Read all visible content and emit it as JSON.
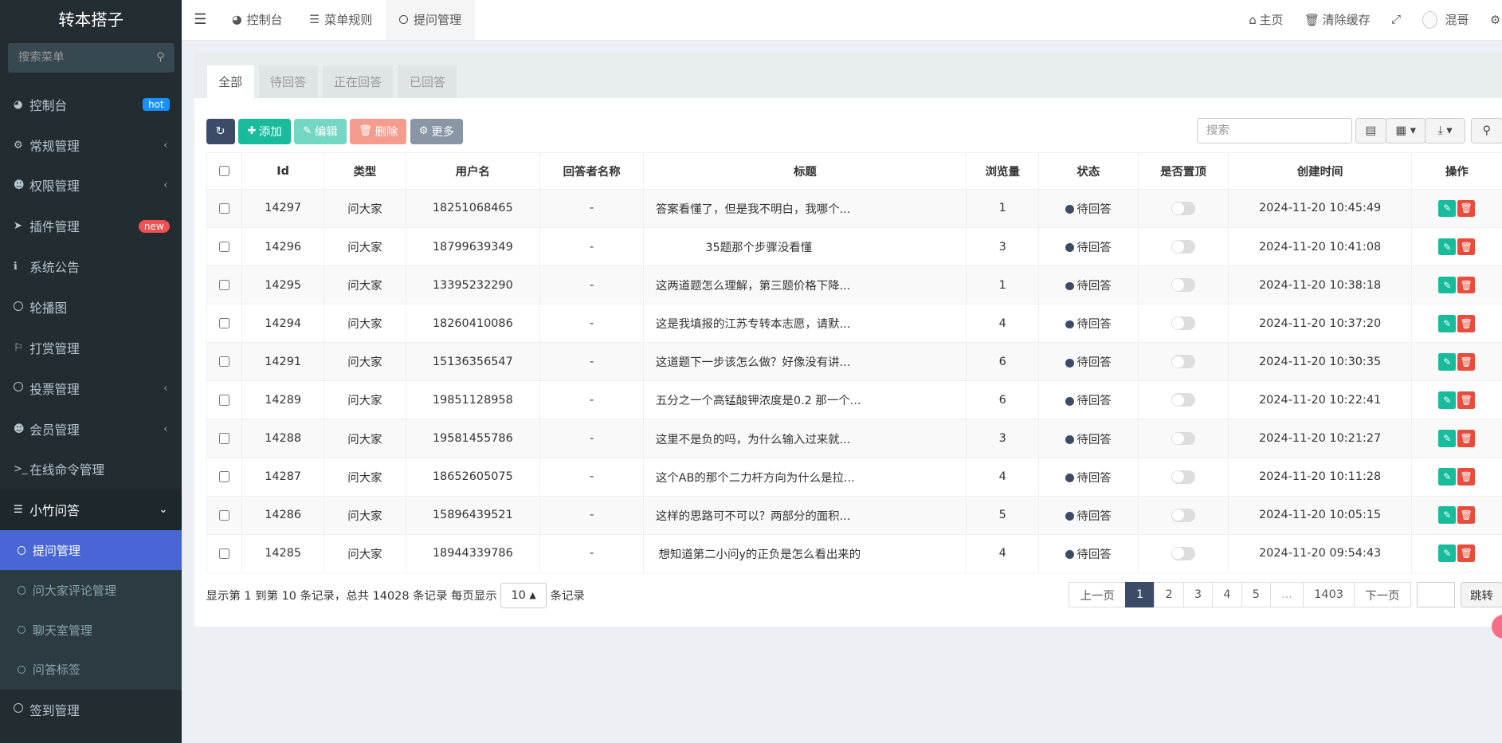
{
  "app": {
    "brand": "转本搭子"
  },
  "sidebar": {
    "search_placeholder": "搜索菜单",
    "items": [
      {
        "label": "控制台",
        "badge": "hot",
        "badge_color": "#1890ff"
      },
      {
        "label": "常规管理"
      },
      {
        "label": "权限管理"
      },
      {
        "label": "插件管理",
        "badge": "new",
        "badge_color": "#f05050"
      },
      {
        "label": "系统公告"
      },
      {
        "label": "轮播图"
      },
      {
        "label": "打赏管理"
      },
      {
        "label": "投票管理"
      },
      {
        "label": "会员管理"
      },
      {
        "label": "在线命令管理"
      },
      {
        "label": "小竹问答"
      }
    ],
    "sub": [
      {
        "label": "提问管理"
      },
      {
        "label": "问大家评论管理"
      },
      {
        "label": "聊天室管理"
      },
      {
        "label": "问答标签"
      }
    ],
    "after": {
      "label": "签到管理"
    }
  },
  "topbar": {
    "tabs": [
      {
        "label": "控制台"
      },
      {
        "label": "菜单规则"
      },
      {
        "label": "提问管理"
      }
    ],
    "home": "主页",
    "clear_cache": "清除缓存",
    "user": "混哥"
  },
  "panel": {
    "tabs": [
      "全部",
      "待回答",
      "正在回答",
      "已回答"
    ],
    "buttons": {
      "add": "添加",
      "edit": "编辑",
      "delete": "删除",
      "more": "更多"
    },
    "search_placeholder": "搜索",
    "columns": [
      "Id",
      "类型",
      "用户名",
      "回答者名称",
      "标题",
      "浏览量",
      "状态",
      "是否置顶",
      "创建时间",
      "操作"
    ],
    "rows": [
      {
        "id": "14297",
        "type": "问大家",
        "user": "18251068465",
        "answerer": "-",
        "title": "答案看懂了，但是我不明白，我哪个...",
        "views": "1",
        "status": "待回答",
        "created": "2024-11-20 10:45:49"
      },
      {
        "id": "14296",
        "type": "问大家",
        "user": "18799639349",
        "answerer": "-",
        "title": "35题那个步骤没看懂",
        "views": "3",
        "status": "待回答",
        "created": "2024-11-20 10:41:08"
      },
      {
        "id": "14295",
        "type": "问大家",
        "user": "13395232290",
        "answerer": "-",
        "title": "这两道题怎么理解，第三题价格下降...",
        "views": "1",
        "status": "待回答",
        "created": "2024-11-20 10:38:18"
      },
      {
        "id": "14294",
        "type": "问大家",
        "user": "18260410086",
        "answerer": "-",
        "title": "这是我填报的江苏专转本志愿，请默...",
        "views": "4",
        "status": "待回答",
        "created": "2024-11-20 10:37:20"
      },
      {
        "id": "14291",
        "type": "问大家",
        "user": "15136356547",
        "answerer": "-",
        "title": "这道题下一步该怎么做？好像没有讲...",
        "views": "6",
        "status": "待回答",
        "created": "2024-11-20 10:30:35"
      },
      {
        "id": "14289",
        "type": "问大家",
        "user": "19851128958",
        "answerer": "-",
        "title": "五分之一个高锰酸钾浓度是0.2 那一个...",
        "views": "6",
        "status": "待回答",
        "created": "2024-11-20 10:22:41"
      },
      {
        "id": "14288",
        "type": "问大家",
        "user": "19581455786",
        "answerer": "-",
        "title": "这里不是负的吗，为什么输入过来就...",
        "views": "3",
        "status": "待回答",
        "created": "2024-11-20 10:21:27"
      },
      {
        "id": "14287",
        "type": "问大家",
        "user": "18652605075",
        "answerer": "-",
        "title": "这个AB的那个二力杆方向为什么是拉...",
        "views": "4",
        "status": "待回答",
        "created": "2024-11-20 10:11:28"
      },
      {
        "id": "14286",
        "type": "问大家",
        "user": "15896439521",
        "answerer": "-",
        "title": "这样的思路可不可以？两部分的面积...",
        "views": "5",
        "status": "待回答",
        "created": "2024-11-20 10:05:15"
      },
      {
        "id": "14285",
        "type": "问大家",
        "user": "18944339786",
        "answerer": "-",
        "title": "想知道第二小问y的正负是怎么看出来的",
        "views": "4",
        "status": "待回答",
        "created": "2024-11-20 09:54:43"
      }
    ],
    "footer": {
      "summary": "显示第 1 到第 10 条记录，总共 14028 条记录 每页显示",
      "page_size": "10",
      "suffix": "条记录"
    },
    "pager": {
      "prev": "上一页",
      "pages": [
        "1",
        "2",
        "3",
        "4",
        "5",
        "...",
        "1403"
      ],
      "next": "下一页",
      "jump": "跳转"
    }
  }
}
